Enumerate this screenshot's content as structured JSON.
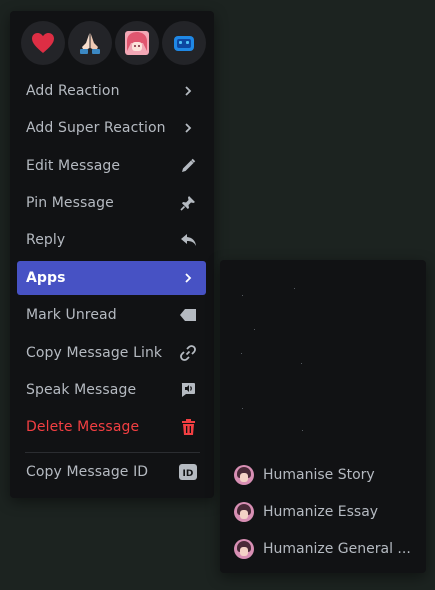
{
  "reactions": [
    {
      "icon": "heart-emoji"
    },
    {
      "icon": "folded-hands-emoji"
    },
    {
      "icon": "anime-avatar-emoji"
    },
    {
      "icon": "blue-bot-emoji"
    }
  ],
  "menu": {
    "items": [
      {
        "label": "Add Reaction",
        "icon": "chevron-right-icon"
      },
      {
        "label": "Add Super Reaction",
        "icon": "chevron-right-icon"
      },
      {
        "label": "Edit Message",
        "icon": "pencil-icon"
      },
      {
        "label": "Pin Message",
        "icon": "pin-icon"
      },
      {
        "label": "Reply",
        "icon": "reply-icon"
      },
      {
        "label": "Apps",
        "icon": "chevron-right-icon"
      },
      {
        "label": "Mark Unread",
        "icon": "mark-unread-icon"
      },
      {
        "label": "Copy Message Link",
        "icon": "link-icon"
      },
      {
        "label": "Speak Message",
        "icon": "speak-icon"
      },
      {
        "label": "Delete Message",
        "icon": "trash-icon"
      },
      {
        "label": "Copy Message ID",
        "icon": "id-badge-icon"
      }
    ]
  },
  "apps_submenu": {
    "items": [
      {
        "label": "Humanise Story"
      },
      {
        "label": "Humanize Essay"
      },
      {
        "label": "Humanize General ..."
      }
    ]
  },
  "colors": {
    "accent": "#4752c4",
    "danger": "#f23f42",
    "menu_bg": "#111214"
  }
}
